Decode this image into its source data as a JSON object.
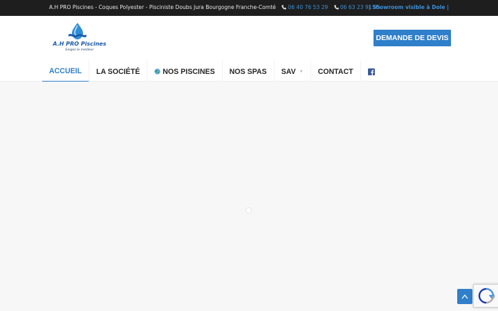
{
  "topbar": {
    "tagline": "A.H PRO Piscines - Coques Polyester - Pisciniste Doubs Jura Bourgogne Franche-Comté",
    "phone1": "06 40 76 53 29",
    "phone2": "06 63 23 91 95",
    "showroom": "| Showroom visible à Dole |"
  },
  "logo": {
    "name": "A.H PRO Piscines",
    "tagline": "Exigez le meilleur"
  },
  "header": {
    "cta_label": "DEMANDE DE DEVIS"
  },
  "nav": {
    "items": [
      {
        "label": "ACCUEIL",
        "active": true
      },
      {
        "label": "LA SOCIÉTÉ"
      },
      {
        "label": "NOS PISCINES",
        "icon": "globe-icon"
      },
      {
        "label": "NOS SPAS"
      },
      {
        "label": "SAV",
        "has_submenu": true
      },
      {
        "label": "CONTACT"
      }
    ],
    "social_icon": "facebook-icon"
  },
  "colors": {
    "accent": "#2f7fca",
    "topbar_bg": "#1e1e1e",
    "page_bg": "#f7f7f7"
  }
}
